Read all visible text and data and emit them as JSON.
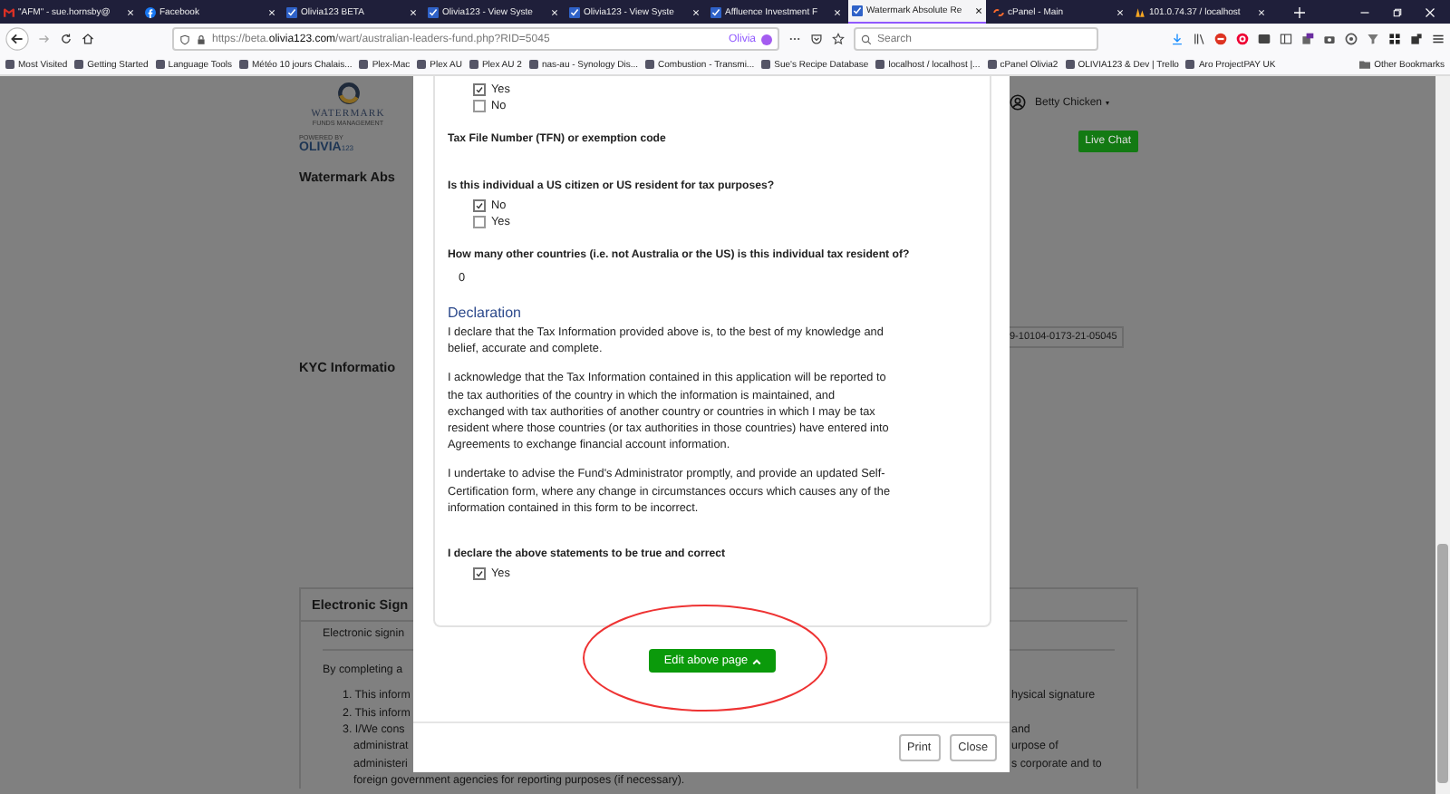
{
  "browser": {
    "tabs": [
      {
        "label": "\"AFM\" - sue.hornsby@",
        "selected": false
      },
      {
        "label": "Facebook",
        "selected": false
      },
      {
        "label": "Olivia123 BETA",
        "selected": false
      },
      {
        "label": "Olivia123 - View Syste",
        "selected": false
      },
      {
        "label": "Olivia123 - View Syste",
        "selected": false
      },
      {
        "label": "Affluence Investment F",
        "selected": false
      },
      {
        "label": "Watermark Absolute Re",
        "selected": true
      },
      {
        "label": "cPanel - Main",
        "selected": false
      },
      {
        "label": "101.0.74.37 / localhost",
        "selected": false
      }
    ],
    "url": {
      "prefix": "https://beta.",
      "domain": "olivia123.com",
      "path": "/wart/australian-leaders-fund.php?RID=5045"
    },
    "container_label": "Olivia",
    "search": {
      "placeholder": "Search"
    },
    "bookmarks": [
      "Most Visited",
      "Getting Started",
      "Language Tools",
      "Météo 10 jours Chalais...",
      "Plex-Mac",
      "Plex AU",
      "Plex AU 2",
      "nas-au - Synology Dis...",
      "Combustion - Transmi...",
      "Sue's Recipe Database",
      "localhost / localhost |...",
      "cPanel Olivia2",
      "OLIVIA123 & Dev | Trello",
      "Aro ProjectPAY UK"
    ],
    "other_bookmarks": "Other Bookmarks"
  },
  "page": {
    "logo": {
      "brand": "WATERMARK",
      "tagline": "FUNDS MANAGEMENT",
      "powered_by": "POWERED BY",
      "product": "OLIVIA",
      "product_suffix": "123"
    },
    "title": "Watermark Abs",
    "section_title": "KYC Informatio",
    "user_name": "Betty Chicken",
    "live_chat": "Live Chat",
    "reference": "9-10104-0173-21-05045",
    "signature_card": {
      "title": "Electronic Sign",
      "subtitle": "Electronic signin",
      "intro": "By completing a",
      "rows": [
        {
          "kind": "item",
          "left": "1. This inform",
          "right": "hysical signature"
        },
        {
          "kind": "item",
          "left": "2. This inform"
        },
        {
          "kind": "item",
          "left": "3. I/We cons",
          "right": "and"
        },
        {
          "kind": "continuation",
          "left": "administrat",
          "right": "urpose of"
        },
        {
          "kind": "continuation",
          "left": "administeri",
          "right": "s corporate and to"
        }
      ],
      "last_line": "foreign government agencies for reporting purposes (if necessary)."
    }
  },
  "modal": {
    "items": [
      {
        "kind": "options",
        "options": [
          {
            "label": "Yes",
            "checked": true
          },
          {
            "label": "No",
            "checked": false
          }
        ]
      },
      {
        "kind": "question",
        "text": "Tax File Number (TFN) or exemption code"
      },
      {
        "kind": "question",
        "text": "Is this individual a US citizen or US resident for tax purposes?"
      },
      {
        "kind": "options",
        "options": [
          {
            "label": "No",
            "checked": true
          },
          {
            "label": "Yes",
            "checked": false
          }
        ]
      },
      {
        "kind": "question",
        "text": "How many other countries (i.e. not Australia or the US) is this individual tax resident of?"
      },
      {
        "kind": "answer",
        "text": "0"
      },
      {
        "kind": "heading",
        "text": "Declaration"
      },
      {
        "kind": "paragraph",
        "text": "I declare that the Tax Information provided above is, to the best of my knowledge and belief, accurate and complete."
      },
      {
        "kind": "paragraph",
        "text": "I acknowledge that the Tax Information contained in this application will be reported to the tax authorities of the country in which the information is maintained, and exchanged with tax authorities of another country or countries in which I may be tax resident where those countries (or tax authorities in those countries) have entered into Agreements to exchange financial account information."
      },
      {
        "kind": "paragraph",
        "text": "I undertake to advise the Fund's Administrator promptly, and provide an updated Self-Certification form, where any change in circumstances occurs which causes any of the information contained in this form to be incorrect."
      },
      {
        "kind": "question",
        "text": "I declare the above statements to be true and correct"
      },
      {
        "kind": "options",
        "options": [
          {
            "label": "Yes",
            "checked": true
          }
        ]
      }
    ],
    "edit_button": "Edit above page",
    "footer_buttons": [
      "Print",
      "Close"
    ]
  }
}
